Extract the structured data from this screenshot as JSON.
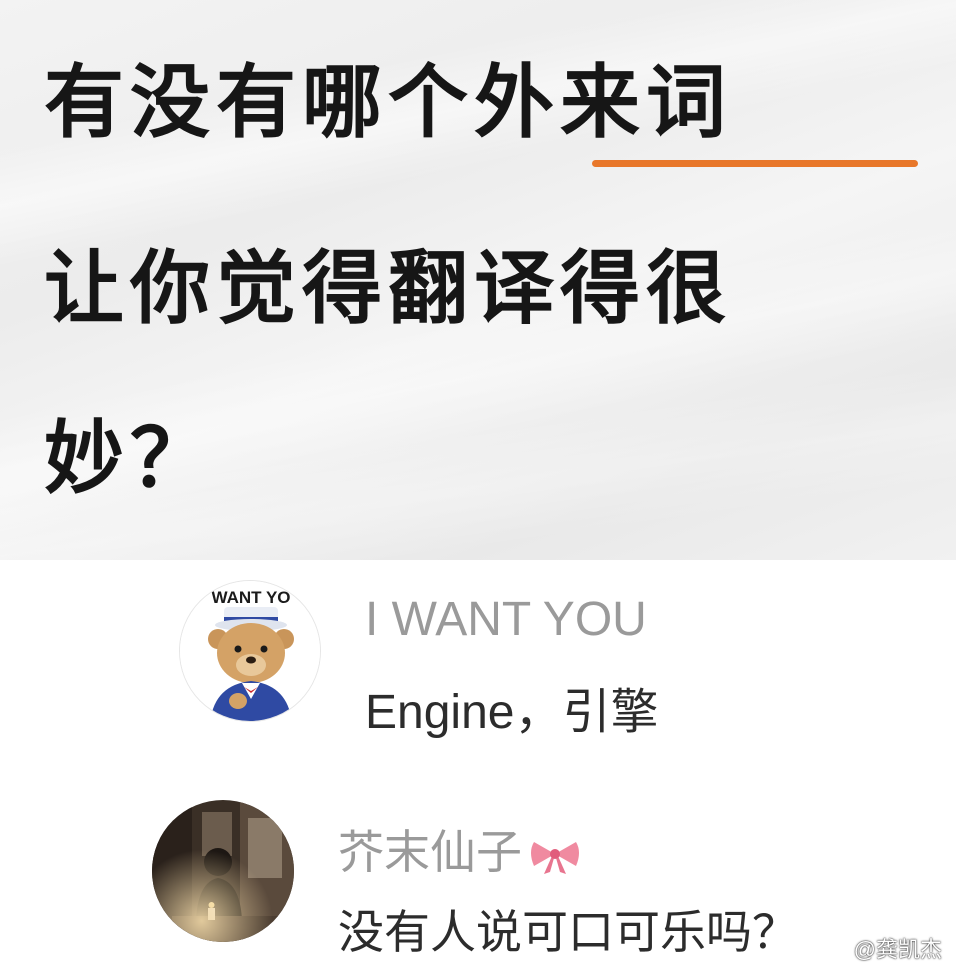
{
  "title_card": {
    "line1_prefix": "有没有哪个",
    "line1_highlight": "外来词",
    "line2": "让你觉得翻译得很",
    "line3": "妙？",
    "accent_color": "#e8772a"
  },
  "comments": [
    {
      "username": "I WANT YOU",
      "text": "Engine，引擎",
      "avatar_icon": "teddy-bear-avatar-icon",
      "avatar_caption": "WANT YO"
    },
    {
      "username": "芥末仙子",
      "badge_icon": "bow-icon",
      "text": "没有人说可口可乐吗？",
      "avatar_icon": "photo-avatar-icon"
    }
  ],
  "watermark": "@龚凯杰"
}
